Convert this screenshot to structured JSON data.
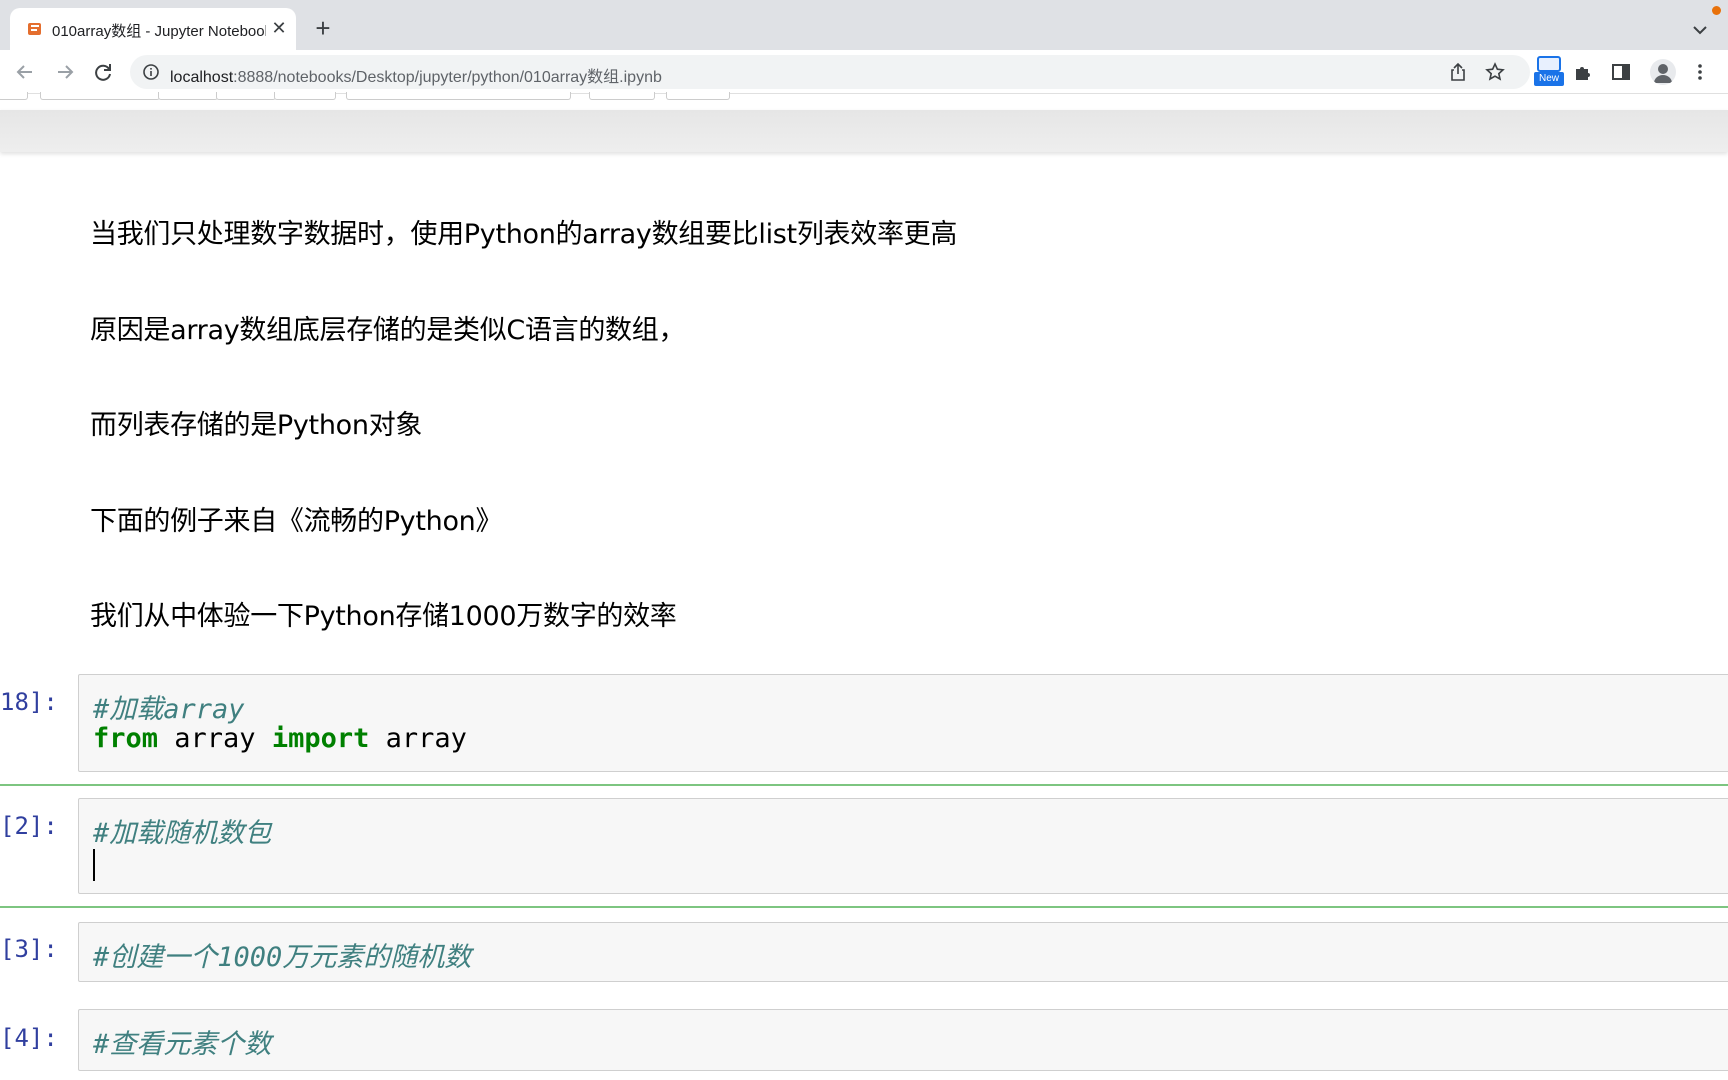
{
  "browser": {
    "tab_title": "010array数组 - Jupyter Notebook",
    "new_tab_symbol": "+",
    "close_symbol": "✕",
    "url_host": "localhost",
    "url_path": ":8888/notebooks/Desktop/jupyter/python/010array数组.ipynb",
    "new_badge": "New"
  },
  "markdown": [
    "当我们只处理数字数据时，使用Python的array数组要比list列表效率更高",
    "原因是array数组底层存储的是类似C语言的数组，",
    "而列表存储的是Python对象",
    "下面的例子来自《流畅的Python》",
    "我们从中体验一下Python存储1000万数字的效率"
  ],
  "cells": [
    {
      "prompt": "18]:",
      "comment": "#加载array",
      "kw1": "from",
      "mod": " array ",
      "kw2": "import",
      "name": " array"
    },
    {
      "prompt": "[2]:",
      "comment": "#加载随机数包"
    },
    {
      "prompt": "[3]:",
      "comment": "#创建一个1000万元素的随机数"
    },
    {
      "prompt": "[4]:",
      "comment": "#查看元素个数"
    }
  ]
}
